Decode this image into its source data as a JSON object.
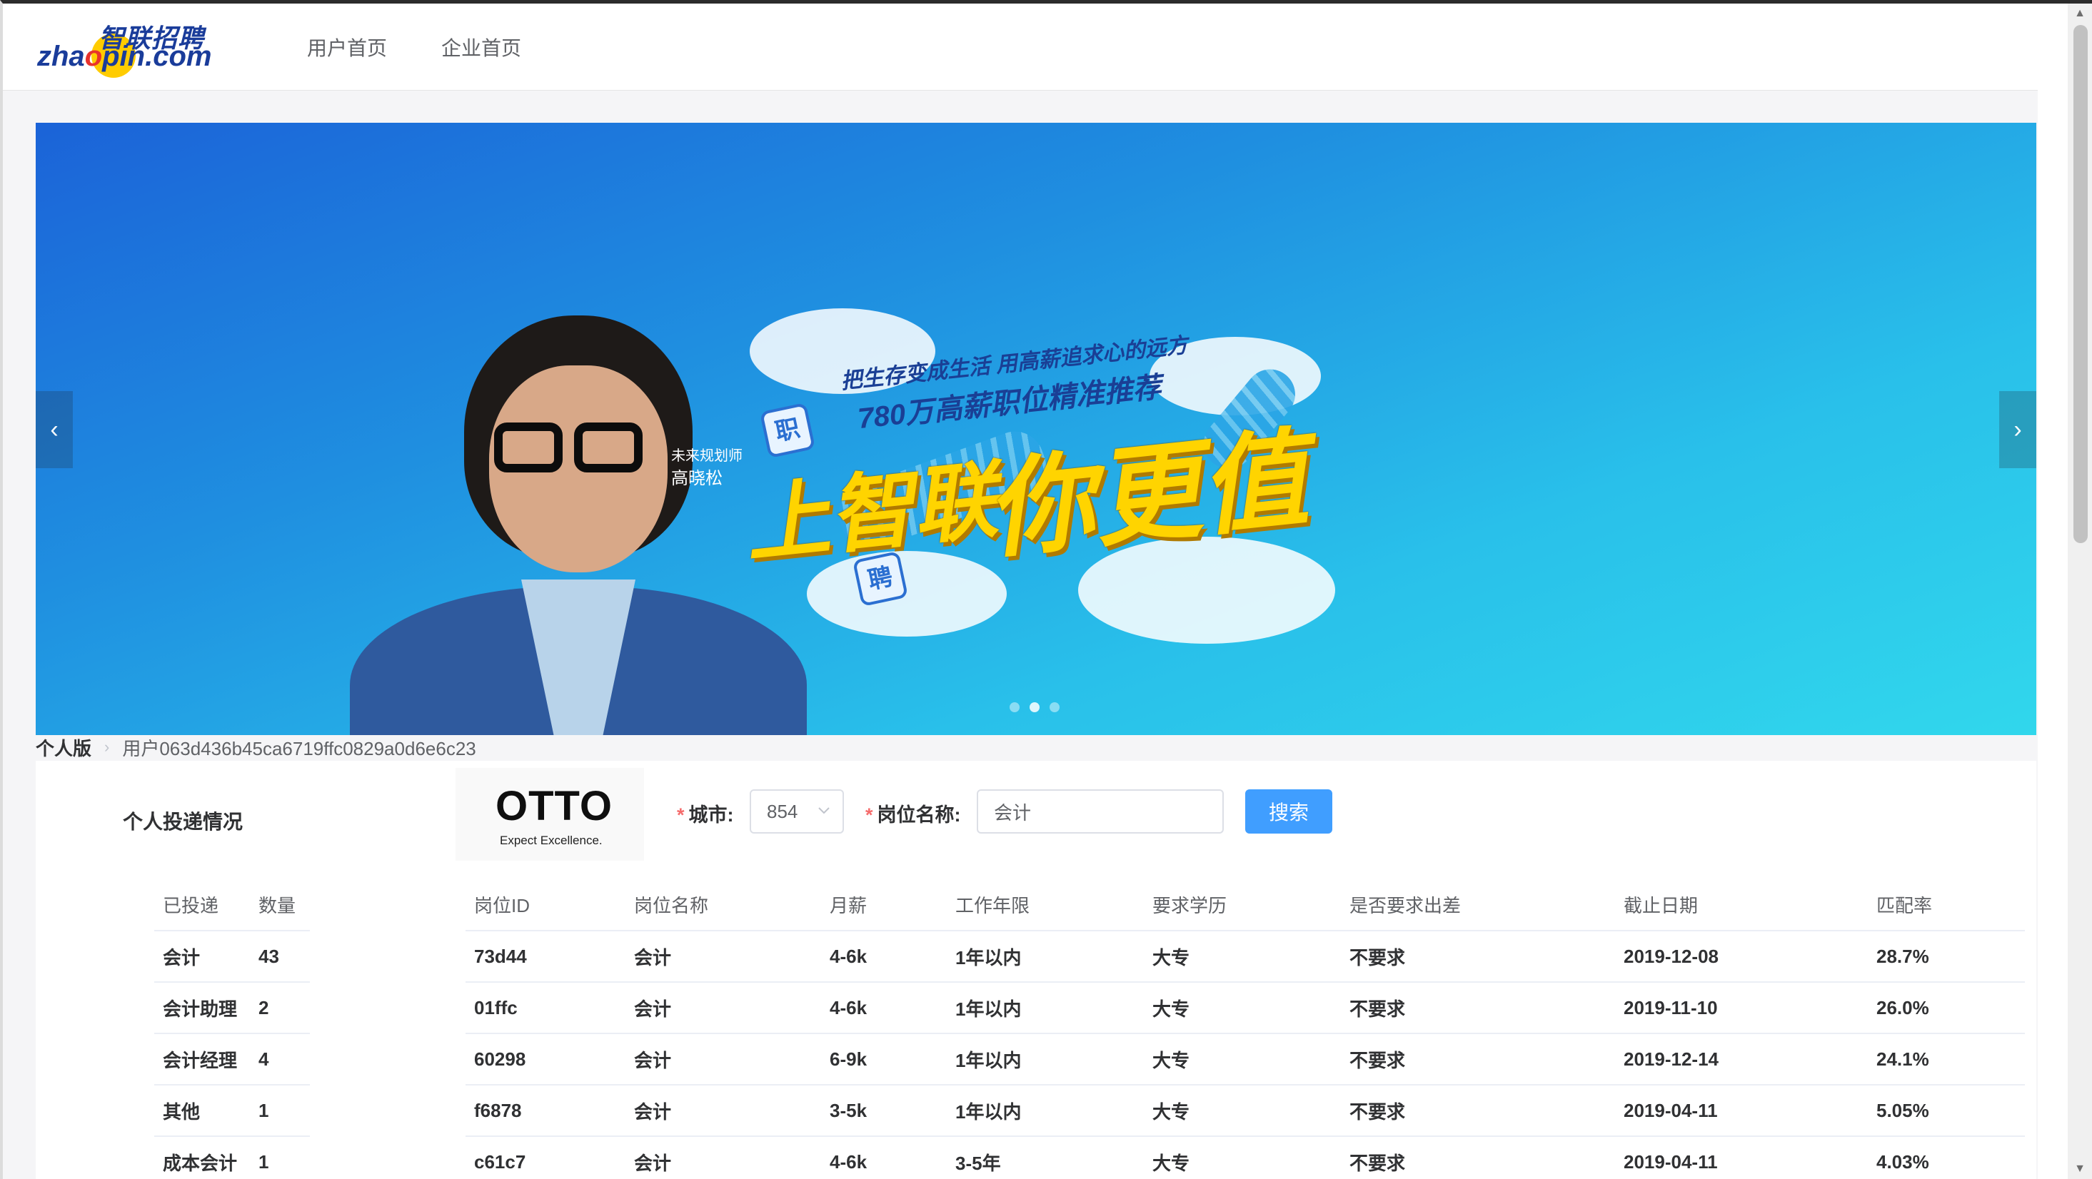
{
  "logo": {
    "cn": "智联招聘",
    "en_pre": "zha",
    "en_mid": "o",
    "en_post": "pin.com"
  },
  "nav": {
    "items": [
      {
        "label": "用户首页"
      },
      {
        "label": "企业首页"
      }
    ]
  },
  "banner": {
    "slogan_line1": "把生存变成生活 用高薪追求心的远方",
    "slogan_line2": "780万高薪职位精准推荐",
    "slogan_main_left": "上智联",
    "slogan_main_right": "你更值",
    "signature_title": "未来规划师",
    "signature_name": "高晓松",
    "tile1": "职",
    "tile2": "聘",
    "prev_icon": "‹",
    "next_icon": "›",
    "slides": 3,
    "active_slide": 2
  },
  "breadcrumb": {
    "first": "个人版",
    "separator": "›",
    "second": "用户063d436b45ca6719ffc0829a0d6e6c23"
  },
  "stats": {
    "title": "个人投递情况",
    "headers": [
      "已投递",
      "数量"
    ],
    "rows": [
      [
        "会计",
        "43"
      ],
      [
        "会计助理",
        "2"
      ],
      [
        "会计经理",
        "4"
      ],
      [
        "其他",
        "1"
      ],
      [
        "成本会计",
        "1"
      ]
    ]
  },
  "company": {
    "name": "OTTO",
    "tagline": "Expect Excellence."
  },
  "search": {
    "city_label": "城市:",
    "city_value": "854",
    "job_label": "岗位名称:",
    "job_value": "会计",
    "required_mark": "*",
    "button": "搜索",
    "chevron_icon": "chevron-down-icon"
  },
  "jobs": {
    "headers": [
      "岗位ID",
      "岗位名称",
      "月薪",
      "工作年限",
      "要求学历",
      "是否要求出差",
      "截止日期",
      "匹配率"
    ],
    "rows": [
      [
        "73d44",
        "会计",
        "4-6k",
        "1年以内",
        "大专",
        "不要求",
        "2019-12-08",
        "28.7%"
      ],
      [
        "01ffc",
        "会计",
        "4-6k",
        "1年以内",
        "大专",
        "不要求",
        "2019-11-10",
        "26.0%"
      ],
      [
        "60298",
        "会计",
        "6-9k",
        "1年以内",
        "大专",
        "不要求",
        "2019-12-14",
        "24.1%"
      ],
      [
        "f6878",
        "会计",
        "3-5k",
        "1年以内",
        "大专",
        "不要求",
        "2019-04-11",
        "5.05%"
      ],
      [
        "c61c7",
        "会计",
        "4-6k",
        "3-5年",
        "大专",
        "不要求",
        "2019-04-11",
        "4.03%"
      ]
    ]
  },
  "colors": {
    "primary": "#409eff",
    "brand_blue": "#1a3c9a",
    "brand_yellow": "#ffcc00",
    "required": "#f56c6c"
  },
  "scrollbar": {
    "up_icon": "▲",
    "down_icon": "▼"
  }
}
